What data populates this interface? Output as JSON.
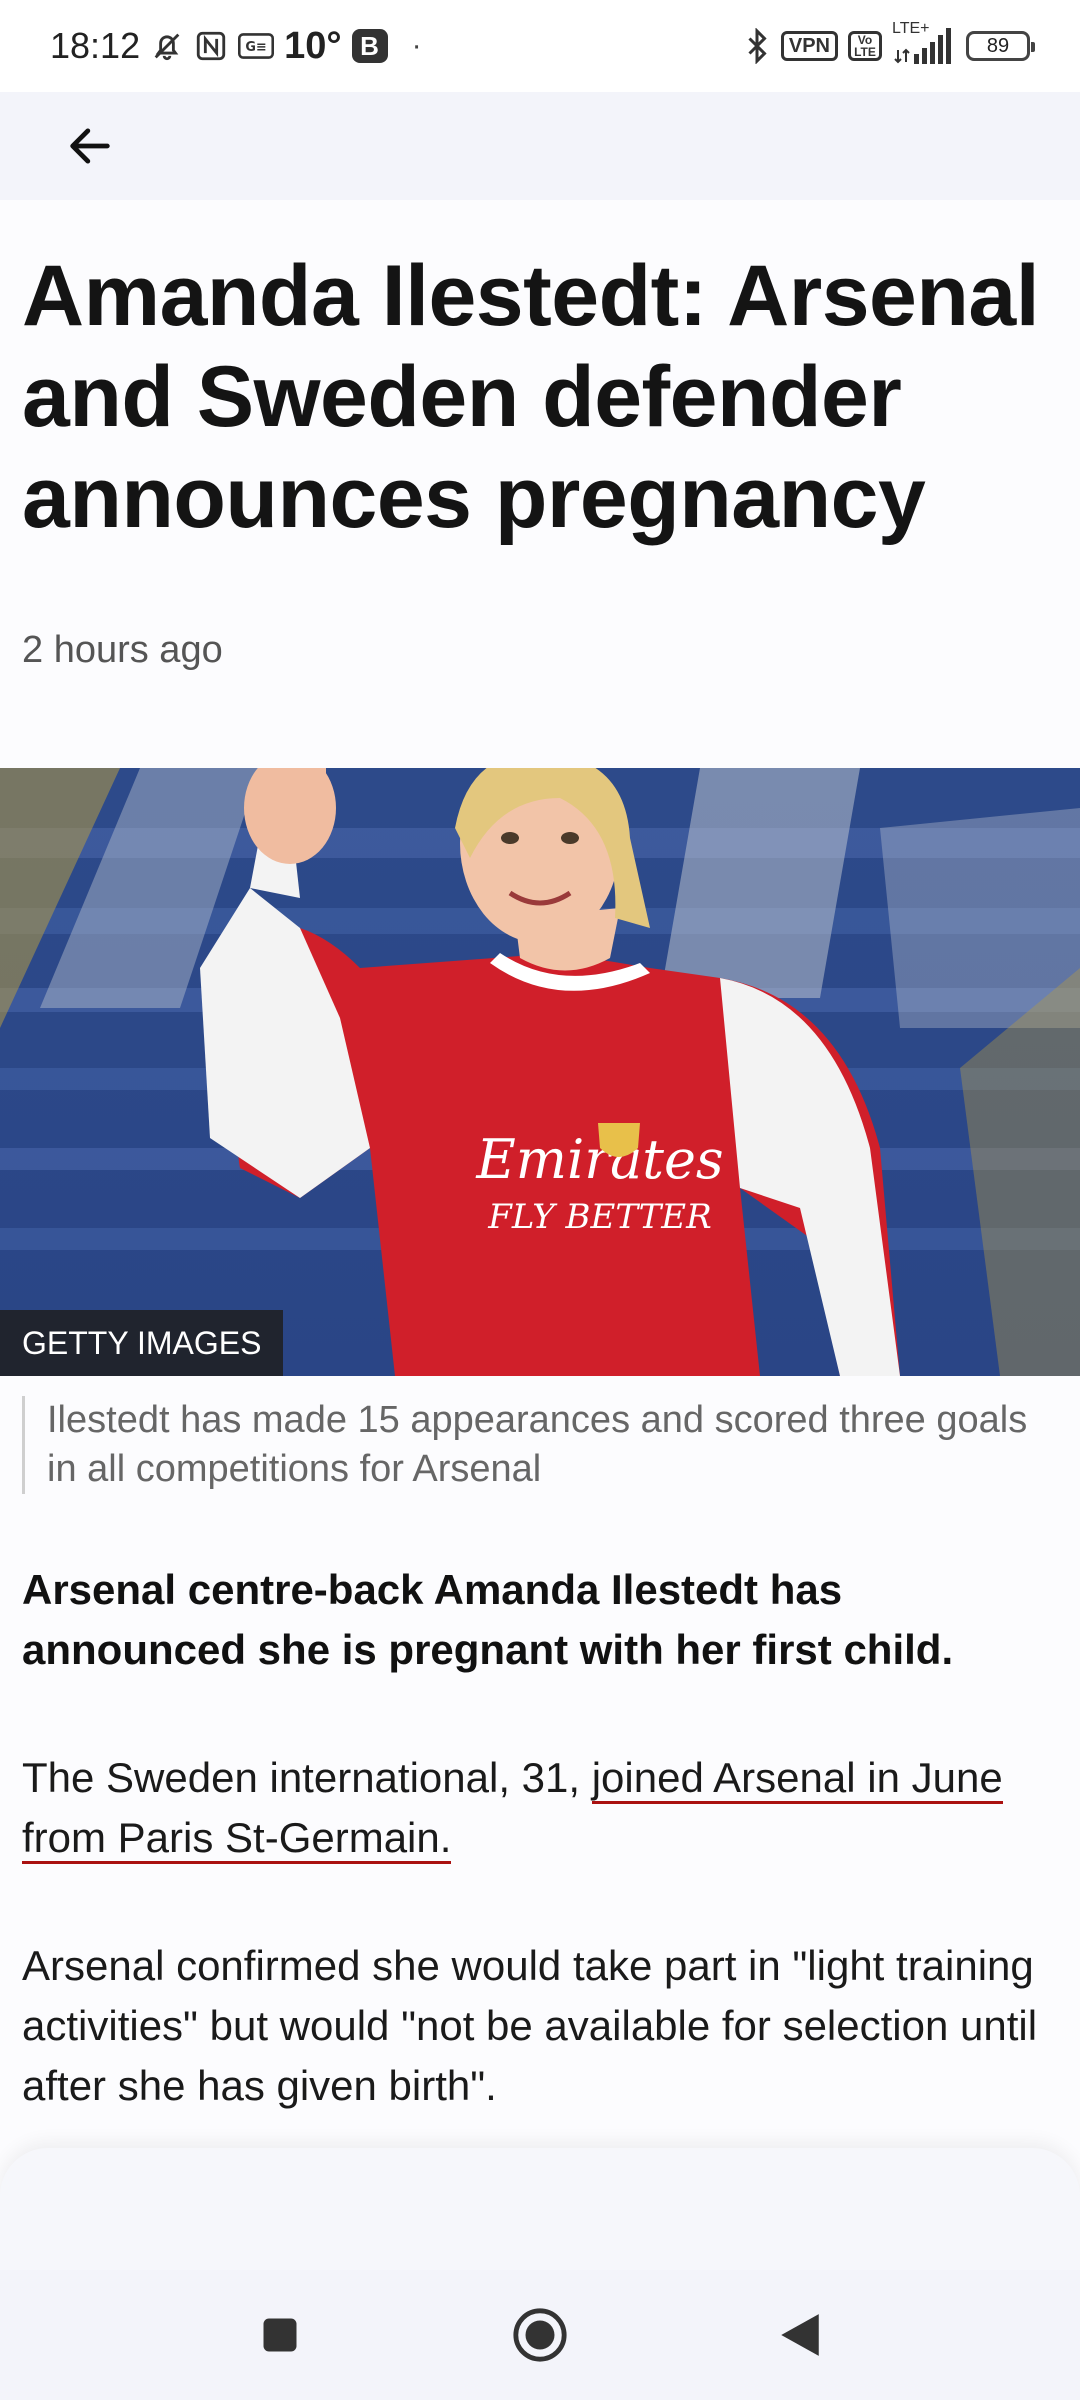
{
  "status_bar": {
    "time": "18:12",
    "temperature": "10°",
    "b_badge": "B",
    "dot": "·",
    "vpn": "VPN",
    "volte": "Vo LTE",
    "lte": "LTE+",
    "battery": "89",
    "icons": [
      "mute-bell-icon",
      "nfc-icon",
      "ge-icon",
      "bluetooth-icon",
      "signal-icon"
    ]
  },
  "article": {
    "headline": "Amanda Ilestedt: Arsenal and Sweden defender announces pregnancy",
    "timestamp": "2 hours ago",
    "image_credit": "GETTY IMAGES",
    "caption": "Ilestedt has made 15 appearances and scored three goals in all competitions for Arsenal",
    "lead": "Arsenal centre-back Amanda Ilestedt has announced she is pregnant with her first child.",
    "para1_prefix": "The Sweden international, 31, ",
    "para1_link": "joined Arsenal in June from Paris St-Germain.",
    "para2": "Arsenal confirmed she would take part in \"light training activities\" but would \"not be available for selection until after she has given birth\"."
  },
  "colors": {
    "link_underline": "#aa1111",
    "top_bar": "#f3f4fa",
    "shirt_red": "#d01f2a"
  },
  "nav": {
    "icons": [
      "recents-square-icon",
      "home-circle-icon",
      "back-triangle-icon"
    ]
  }
}
